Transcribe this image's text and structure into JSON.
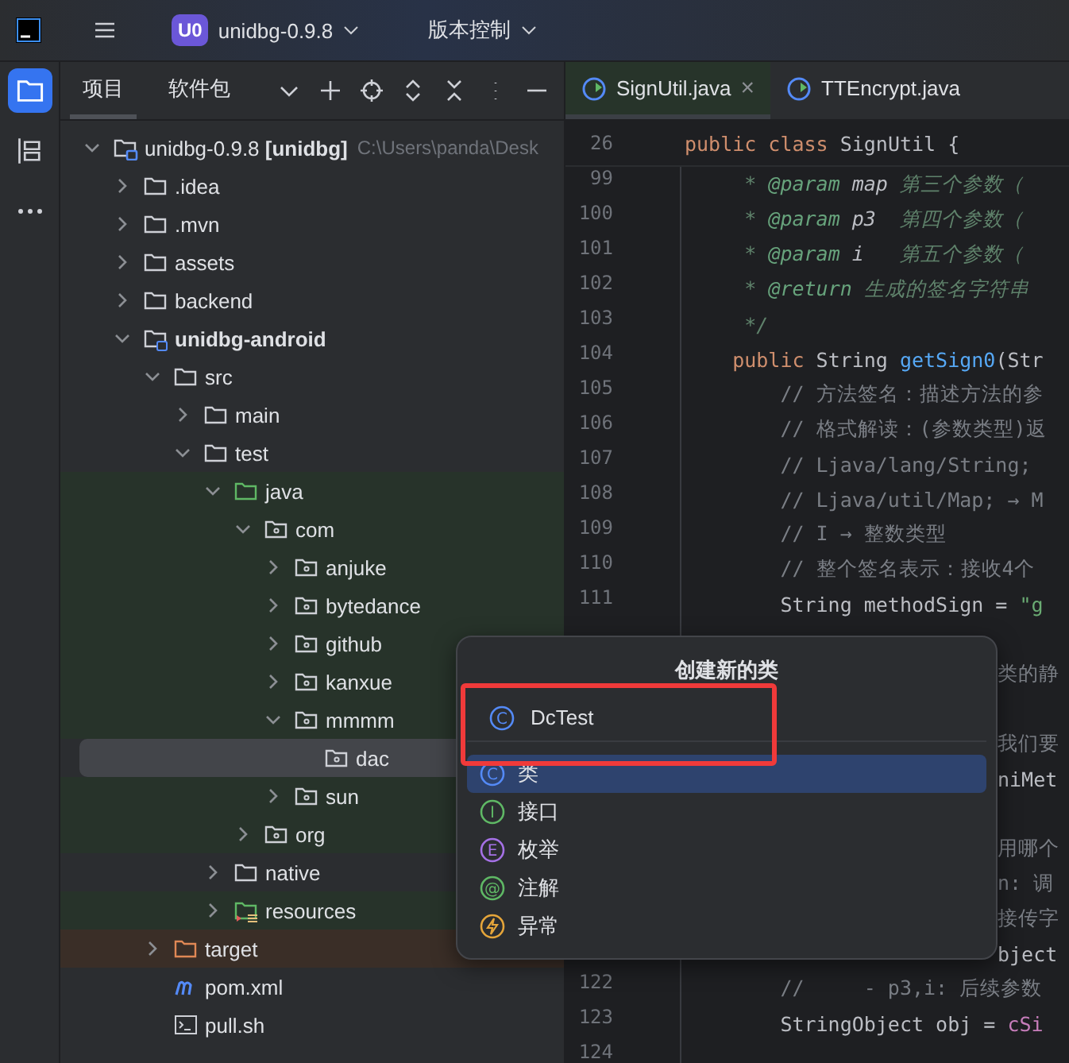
{
  "title_bar": {
    "project_badge": "U0",
    "project": "unidbg-0.9.8",
    "vcs": "版本控制"
  },
  "side_strip": [
    {
      "kind": "folder",
      "selected": true
    },
    {
      "kind": "structure",
      "selected": false
    },
    {
      "kind": "more",
      "selected": false
    }
  ],
  "project_panel": {
    "tabs": [
      {
        "label": "项目",
        "selected": true
      },
      {
        "label": "软件包",
        "selected": false
      }
    ]
  },
  "tree": [
    {
      "label": "unidbg-0.9.8 **[unidbg]**",
      "hint": "C:\\Users\\panda\\Desk",
      "kind": "project",
      "expanded": true,
      "selected": false,
      "children": [
        {
          "label": ".idea",
          "kind": "folder",
          "expanded": false,
          "selected": false
        },
        {
          "label": ".mvn",
          "kind": "folder",
          "expanded": false,
          "selected": false
        },
        {
          "label": "assets",
          "kind": "folder",
          "expanded": false,
          "selected": false
        },
        {
          "label": "backend",
          "kind": "folder",
          "expanded": false,
          "selected": false
        },
        {
          "label": "unidbg-android",
          "kind": "module",
          "expanded": true,
          "selected": false,
          "children": [
            {
              "label": "src",
              "kind": "folder",
              "expanded": true,
              "selected": false,
              "children": [
                {
                  "label": "main",
                  "kind": "folder",
                  "expanded": false,
                  "selected": false
                },
                {
                  "label": "test",
                  "kind": "folder",
                  "expanded": true,
                  "selected": false,
                  "children": [
                    {
                      "label": "java",
                      "kind": "test-root",
                      "expanded": true,
                      "selected": false,
                      "children": [
                        {
                          "label": "com",
                          "kind": "package",
                          "expanded": true,
                          "selected": false,
                          "children": [
                            {
                              "label": "anjuke",
                              "kind": "package",
                              "expanded": false,
                              "selected": false
                            },
                            {
                              "label": "bytedance",
                              "kind": "package",
                              "expanded": false,
                              "selected": false
                            },
                            {
                              "label": "github",
                              "kind": "package",
                              "expanded": false,
                              "selected": false
                            },
                            {
                              "label": "kanxue",
                              "kind": "package",
                              "expanded": false,
                              "selected": false
                            },
                            {
                              "label": "mmmm",
                              "kind": "package",
                              "expanded": true,
                              "selected": false,
                              "children": [
                                {
                                  "label": "dac",
                                  "kind": "package",
                                  "selected": true
                                }
                              ]
                            },
                            {
                              "label": "sun",
                              "kind": "package",
                              "expanded": false,
                              "selected": false
                            }
                          ]
                        },
                        {
                          "label": "org",
                          "kind": "package",
                          "expanded": false,
                          "selected": false
                        }
                      ]
                    },
                    {
                      "label": "native",
                      "kind": "folder",
                      "expanded": false,
                      "selected": false
                    },
                    {
                      "label": "resources",
                      "kind": "test-resources",
                      "expanded": false,
                      "selected": false
                    }
                  ]
                }
              ]
            },
            {
              "label": "target",
              "kind": "excluded",
              "expanded": false,
              "selected": false
            },
            {
              "label": "pom.xml",
              "kind": "maven",
              "selected": false
            },
            {
              "label": "pull.sh",
              "kind": "shell",
              "selected": false
            }
          ]
        }
      ]
    }
  ],
  "editor_tabs": [
    {
      "label": "SignUtil.java",
      "selected": true,
      "close": "×"
    },
    {
      "label": "TTEncrypt.java",
      "selected": false
    }
  ],
  "sticky_line": {
    "number": "26",
    "segments": [
      {
        "text": "public class ",
        "kind": "keyword"
      },
      {
        "text": "SignUtil {",
        "kind": "plain"
      }
    ]
  },
  "code_lines": [
    {
      "kind": "numbered",
      "number": "99",
      "segments": [
        {
          "text": "     * ",
          "kind": "doc"
        },
        {
          "text": "@param",
          "kind": "tag"
        },
        {
          "text": " map ",
          "kind": "docref"
        },
        {
          "text": "第三个参数（",
          "kind": "doc"
        }
      ]
    },
    {
      "kind": "numbered",
      "number": "100",
      "segments": [
        {
          "text": "     * ",
          "kind": "doc"
        },
        {
          "text": "@param",
          "kind": "tag"
        },
        {
          "text": " p3  ",
          "kind": "docref"
        },
        {
          "text": "第四个参数（",
          "kind": "doc"
        }
      ]
    },
    {
      "kind": "numbered",
      "number": "101",
      "segments": [
        {
          "text": "     * ",
          "kind": "doc"
        },
        {
          "text": "@param",
          "kind": "tag"
        },
        {
          "text": " i   ",
          "kind": "docref"
        },
        {
          "text": "第五个参数（",
          "kind": "doc"
        }
      ]
    },
    {
      "kind": "numbered",
      "number": "102",
      "segments": [
        {
          "text": "     * ",
          "kind": "doc"
        },
        {
          "text": "@return",
          "kind": "tag"
        },
        {
          "text": " 生成的签名字符串",
          "kind": "doc"
        }
      ]
    },
    {
      "kind": "numbered",
      "number": "103",
      "segments": [
        {
          "text": "     */",
          "kind": "doc"
        }
      ]
    },
    {
      "kind": "numbered",
      "number": "104",
      "segments": [
        {
          "text": "    public ",
          "kind": "keyword"
        },
        {
          "text": "String ",
          "kind": "plain"
        },
        {
          "text": "getSign0",
          "kind": "method"
        },
        {
          "text": "(Str",
          "kind": "plain"
        }
      ]
    },
    {
      "kind": "numbered",
      "number": "105",
      "segments": [
        {
          "text": "        // 方法签名：描述方法的参",
          "kind": "comment"
        }
      ]
    },
    {
      "kind": "numbered",
      "number": "106",
      "segments": [
        {
          "text": "        // 格式解读：(参数类型)返",
          "kind": "comment"
        }
      ]
    },
    {
      "kind": "numbered",
      "number": "107",
      "segments": [
        {
          "text": "        // Ljava/lang/String;",
          "kind": "comment"
        }
      ]
    },
    {
      "kind": "numbered",
      "number": "108",
      "segments": [
        {
          "text": "        // Ljava/util/Map; → M",
          "kind": "comment"
        }
      ]
    },
    {
      "kind": "numbered",
      "number": "109",
      "segments": [
        {
          "text": "        // I → 整数类型",
          "kind": "comment"
        }
      ]
    },
    {
      "kind": "numbered",
      "number": "110",
      "segments": [
        {
          "text": "        // 整个签名表示：接收4个",
          "kind": "comment"
        }
      ]
    },
    {
      "kind": "numbered",
      "number": "111",
      "segments": [
        {
          "text": "        String methodSign = ",
          "kind": "plain"
        },
        {
          "text": "\"g",
          "kind": "string"
        }
      ]
    },
    {
      "kind": "blank"
    },
    {
      "kind": "tail",
      "segments": [
        {
          "text": "类的静",
          "kind": "comment"
        }
      ]
    },
    {
      "kind": "blank"
    },
    {
      "kind": "tail",
      "segments": [
        {
          "text": "我们要",
          "kind": "comment"
        }
      ]
    },
    {
      "kind": "tail",
      "segments": [
        {
          "text": "niMet",
          "kind": "plain"
        }
      ]
    },
    {
      "kind": "blank"
    },
    {
      "kind": "tail",
      "segments": [
        {
          "text": "用哪个",
          "kind": "comment"
        }
      ]
    },
    {
      "kind": "tail",
      "segments": [
        {
          "text": "n: 调",
          "kind": "comment"
        }
      ]
    },
    {
      "kind": "tail",
      "segments": [
        {
          "text": "接传字",
          "kind": "comment"
        }
      ]
    },
    {
      "kind": "tail",
      "segments": [
        {
          "text": "bject",
          "kind": "plain"
        }
      ]
    },
    {
      "kind": "numbered",
      "number": "122",
      "segments": [
        {
          "text": "        //     - p3,i: 后续参数",
          "kind": "comment"
        }
      ]
    },
    {
      "kind": "numbered",
      "number": "123",
      "segments": [
        {
          "text": "        StringObject obj = ",
          "kind": "plain"
        },
        {
          "text": "cSi",
          "kind": "field"
        }
      ]
    },
    {
      "kind": "numbered",
      "number": "124"
    }
  ],
  "popup": {
    "title": "创建新的类",
    "value": "DcTest",
    "value_glyph": "C",
    "highlighted": true,
    "items": [
      {
        "label": "类",
        "kind": "class",
        "glyph": "C",
        "selected": true
      },
      {
        "label": "接口",
        "kind": "interface",
        "glyph": "I",
        "selected": false
      },
      {
        "label": "枚举",
        "kind": "enum",
        "glyph": "E",
        "selected": false
      },
      {
        "label": "注解",
        "kind": "annotation",
        "glyph": "@",
        "selected": false
      },
      {
        "label": "异常",
        "kind": "exception",
        "selected": false
      }
    ]
  }
}
